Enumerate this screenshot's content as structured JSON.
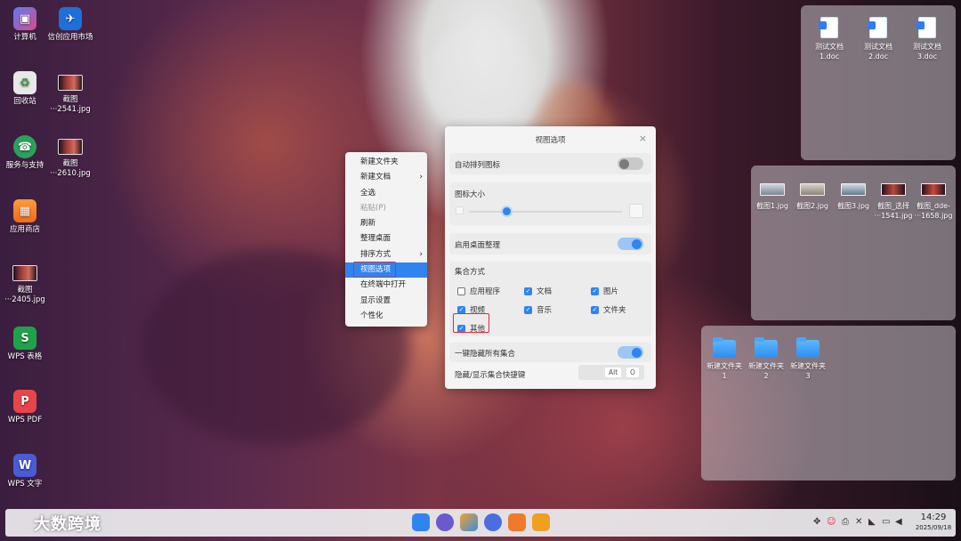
{
  "desktop_icons": [
    {
      "label": "计算机"
    },
    {
      "label": "信创应用市场"
    },
    {
      "label": "回收站"
    },
    {
      "label": "截图\n···2541.jpg"
    },
    {
      "label": "服务与支持"
    },
    {
      "label": "截图\n···2610.jpg"
    },
    {
      "label": "应用商店"
    },
    {
      "label": "截图\n···2405.jpg"
    },
    {
      "label": "WPS 表格"
    },
    {
      "label": "WPS PDF"
    },
    {
      "label": "WPS 文字"
    }
  ],
  "collections": {
    "docs": [
      "测试文档\n1.doc",
      "测试文档\n2.doc",
      "测试文档\n3.doc"
    ],
    "images": [
      "截图1.jpg",
      "截图2.jpg",
      "截图3.jpg",
      "截图_选择\n···1541.jpg",
      "截图_dde-\n···1658.jpg"
    ],
    "folders": [
      "新建文件夹\n1",
      "新建文件夹\n2",
      "新建文件夹\n3"
    ]
  },
  "context_menu": {
    "items": [
      "新建文件夹",
      "新建文档",
      "全选",
      "粘贴(P)",
      "刷新",
      "整理桌面",
      "排序方式",
      "视图选项",
      "在终端中打开",
      "显示设置",
      "个性化"
    ],
    "submenu_arrow": "›"
  },
  "dialog": {
    "title": "视图选项",
    "close": "×",
    "auto_arrange": "自动排列图标",
    "icon_size": "图标大小",
    "icon_size_level": 0.25,
    "enable_organize": "启用桌面整理",
    "collection_mode": "集合方式",
    "checks": [
      {
        "label": "应用程序",
        "checked": false
      },
      {
        "label": "文档",
        "checked": true
      },
      {
        "label": "图片",
        "checked": true
      },
      {
        "label": "视频",
        "checked": true
      },
      {
        "label": "音乐",
        "checked": true
      },
      {
        "label": "文件夹",
        "checked": true
      },
      {
        "label": "其他",
        "checked": true
      }
    ],
    "hide_all": "一键隐藏所有集合",
    "shortcut_label": "隐藏/显示集合快捷键",
    "key1": "Alt",
    "key2": "O"
  },
  "taskbar": {
    "time": "14:29",
    "date": "2025/09/18"
  },
  "watermark": "大数跨境",
  "colors": {
    "accent": "#2f84f0",
    "highlight": "#e02b3c"
  }
}
